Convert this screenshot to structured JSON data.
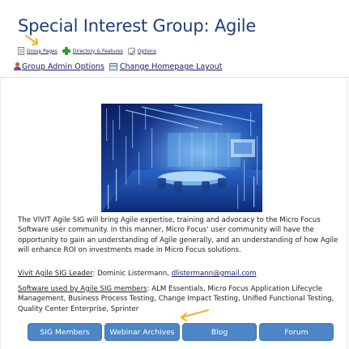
{
  "page": {
    "title": "Special Interest Group: Agile"
  },
  "toolbar": {
    "items": [
      {
        "label": "Group Pages",
        "icon": "document-icon"
      },
      {
        "label": "Directory & Features",
        "icon": "add-icon"
      },
      {
        "label": "Options",
        "icon": "options-icon"
      }
    ]
  },
  "admin": {
    "group_admin_label": "Group Admin Options",
    "change_layout_label": "Change Homepage Layout"
  },
  "content": {
    "description": "The VIVIT Agile SIG will bring Agile expertise, training and advocacy to the Micro Focus Software user community. In this manner, Micro Focus' user community will have the opportunity to gain an understanding of Agile generally, and an understanding of how Agile will enhance ROI on investments made in Micro Focus solutions.",
    "leader_label": "Vivit Agile SIG Leader",
    "leader_sep": ":  Dominic Listermann, ",
    "leader_email": "dlistermann@gmail.com",
    "software_label": "Software used by Agile SIG members",
    "software_text": ": ALM Essentials, Micro Focus Application Lifecycle Management, Business Process Testing, Change Impact Testing, Unified Functional Testing, Quality Center Enterprise, Sprinter"
  },
  "buttons": {
    "sig_members": "SIG Members",
    "webinar_archives": "Webinar Archives",
    "blog": "Blog",
    "forum": "Forum"
  },
  "colors": {
    "title": "#1f3f7a",
    "link": "#1a1a66",
    "button": "#4d86c6",
    "annotation_arrow": "#f2b322"
  }
}
